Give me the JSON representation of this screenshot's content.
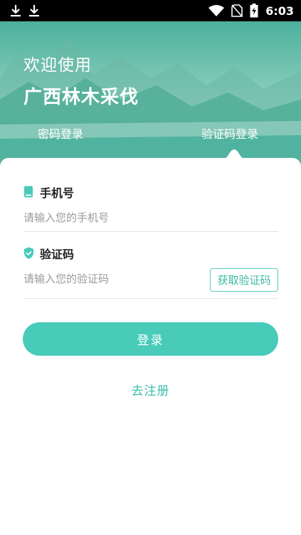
{
  "statusbar": {
    "time": "6:03",
    "icons": [
      "download-icon",
      "download-icon",
      "wifi-icon",
      "no-sim-icon",
      "battery-charging-icon"
    ]
  },
  "header": {
    "welcome": "欢迎使用",
    "app_name": "广西林木采伐"
  },
  "tabs": [
    {
      "label": "密码登录",
      "active": false
    },
    {
      "label": "验证码登录",
      "active": true
    }
  ],
  "form": {
    "phone_label": "手机号",
    "phone_placeholder": "请输入您的手机号",
    "phone_value": "",
    "code_label": "验证码",
    "code_placeholder": "请输入您的验证码",
    "code_value": "",
    "get_code_label": "获取验证码",
    "login_label": "登录",
    "register_label": "去注册"
  },
  "colors": {
    "accent": "#48cbb9",
    "accent_text": "#3cb9a5",
    "header_green": "#2a9c86"
  }
}
